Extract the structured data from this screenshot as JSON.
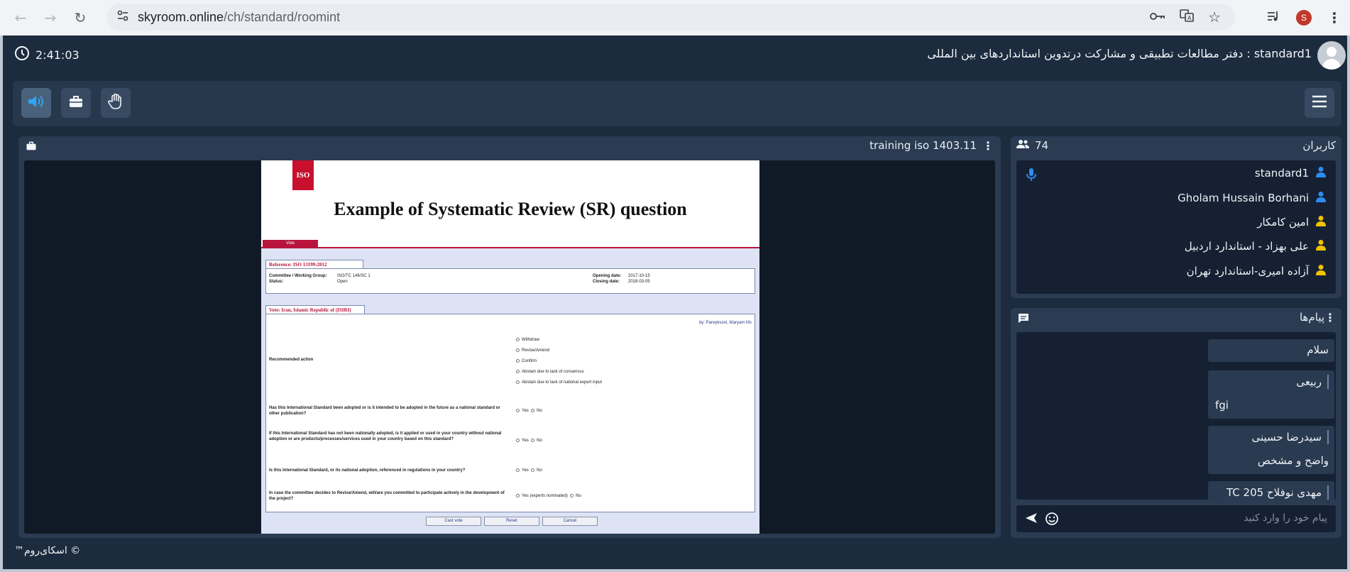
{
  "browser": {
    "url_host": "skyroom.online",
    "url_path": "/ch/standard/roomint",
    "profile_initial": "S"
  },
  "header": {
    "timer": "2:41:03",
    "room_title": "standard1 : دفتر مطالعات تطبیقی و مشارکت درتدوین استانداردهای بین المللی"
  },
  "stage": {
    "title": "training iso 1403.11",
    "slide": {
      "logo": "ISO",
      "heading": "Example of Systematic Review  (SR) question",
      "vote_tab": "Vote",
      "reference": "Reference: ISO 13199:2012",
      "committee_label": "Committee / Working Group:",
      "committee_value": "ISO/TC 146/SC 1",
      "status_label": "Status:",
      "status_value": "Open",
      "opening_label": "Opening date:",
      "opening_value": "2017-10-15",
      "closing_label": "Closing date:",
      "closing_value": "2018-03-05",
      "vote_box_title": "Vote:  Iran, Islamic Republic of (ISIRI)",
      "by_line": "by: Pareyksoni, Maryam Ms",
      "recommended_action": "Recommended action",
      "options": [
        "Withdraw",
        "Revise/Amend",
        "Confirm",
        "Abstain due to lack of consensus",
        "Abstain due to lack of national expert input"
      ],
      "q1": "Has this International Standard been adopted or is it intended to be adopted in the future as a national standard or other publication?",
      "q2": "If this International Standard has not been nationally adopted, is it applied or used in your country without national adoption or are products/processes/services used in your country based on this standard?",
      "q3": "Is this International Standard, or its national adoption, referenced in regulations in your country?",
      "q4": "In case the committee decides to Revise/Amend, will/are you committed to participate actively in the development of the project?",
      "yes": "Yes",
      "no": "No",
      "yes_experts": "Yes (experts nominated)",
      "cast_vote": "Cast vote",
      "reset": "Reset",
      "cancel": "Cancel"
    }
  },
  "users": {
    "title": "کاربران",
    "count": "74",
    "list": [
      {
        "name": "standard1",
        "color": "#2e8cf0"
      },
      {
        "name": "Gholam Hussain Borhani",
        "color": "#2e8cf0"
      },
      {
        "name": "امین کامکار",
        "color": "#f2c200"
      },
      {
        "name": "علی بهزاد - استاندارد اردبیل",
        "color": "#f2c200"
      },
      {
        "name": "آزاده امیری-استاندارد تهران",
        "color": "#f2c200"
      }
    ]
  },
  "chat": {
    "title": "پیام‌ها",
    "messages": [
      {
        "name": "",
        "text": "سلام"
      },
      {
        "name": "ربیعی",
        "text": "fgi"
      },
      {
        "name": "سیدرضا حسینی",
        "text": "واضح و مشخص"
      },
      {
        "name": "مهدی نوفلاح TC 205",
        "text": ""
      }
    ],
    "placeholder": "پیام خود را وارد کنید"
  },
  "footer": {
    "copyright": "© اسکای‌روم™"
  }
}
